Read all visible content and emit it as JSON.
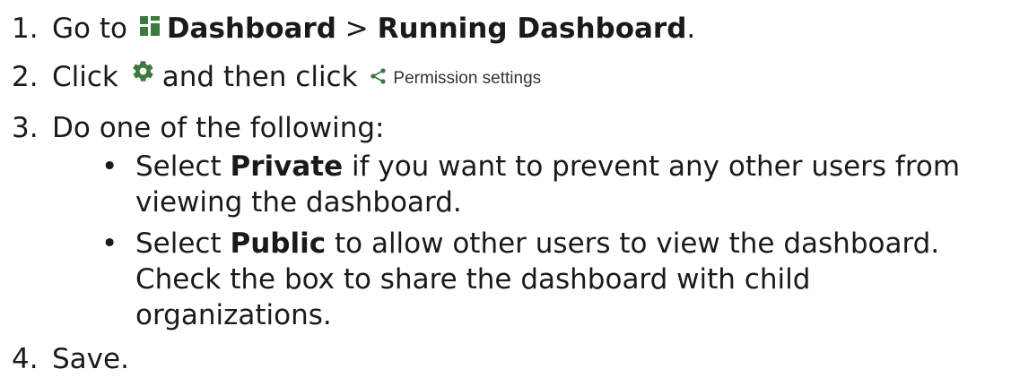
{
  "steps": {
    "s1": {
      "num": "1.",
      "pre": "Go to",
      "dashboard": "Dashboard",
      "sep": ">",
      "running": "Running Dashboard",
      "end": "."
    },
    "s2": {
      "num": "2.",
      "pre": "Click",
      "mid": "and then click",
      "permission": "Permission settings"
    },
    "s3": {
      "num": "3.",
      "text": "Do one of the following:"
    },
    "b1": {
      "pre": "Select",
      "bold": "Private",
      "rest_line1": "if you want to prevent any other users from",
      "line2": "viewing the dashboard."
    },
    "b2": {
      "pre": "Select",
      "bold": "Public",
      "rest_line1": "to allow other users to view the dashboard.",
      "line2": "Check the box to share the dashboard with child",
      "line3": "organizations."
    },
    "s4": {
      "num": "4.",
      "text": "Save."
    }
  },
  "icons": {
    "dashboard": "dashboard-icon",
    "gear": "gear-icon",
    "share": "share-icon"
  },
  "colors": {
    "dashboard_icon": "#3a7a3f",
    "gear_icon": "#3a7a3f",
    "share_icon": "#3a7a3f"
  }
}
